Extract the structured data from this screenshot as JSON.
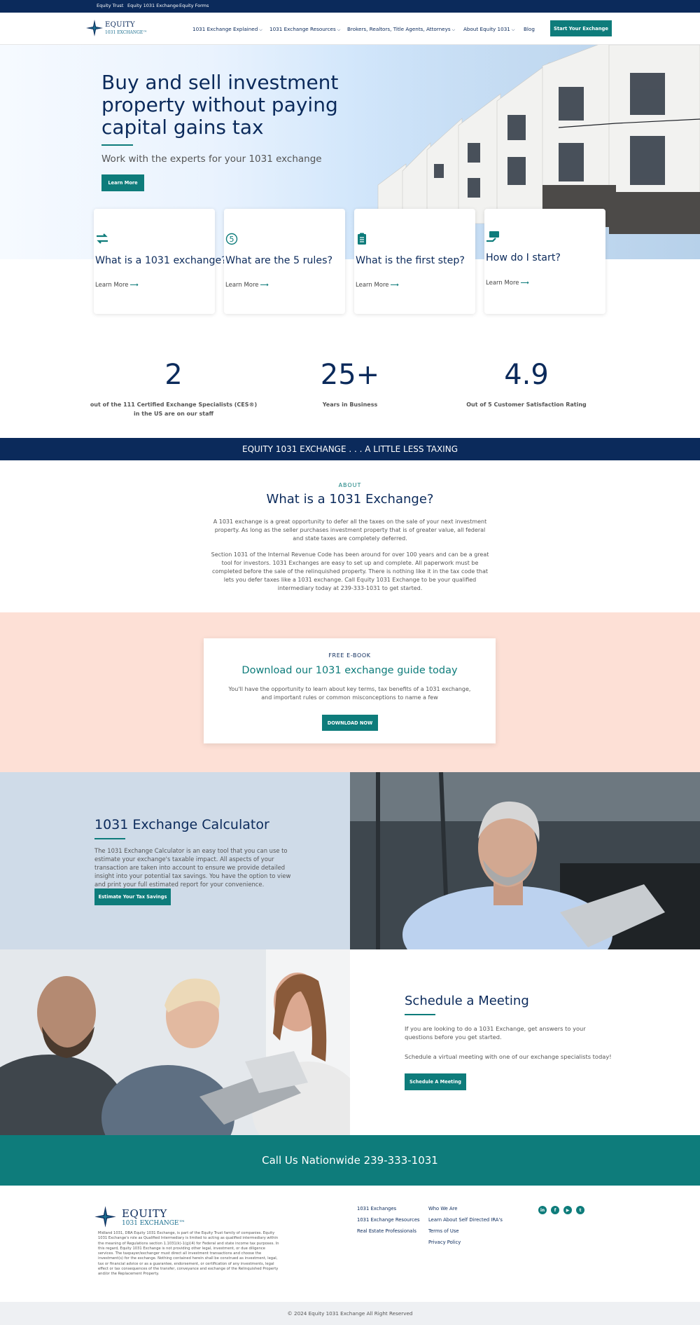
{
  "utility_bar": {
    "links": [
      "Equity Trust",
      "Equity 1031 Exchange",
      "Equity Forms"
    ]
  },
  "header": {
    "logo_line1": "EQUITY",
    "logo_line2": "1031 EXCHANGE™",
    "nav": [
      {
        "label": "1031 Exchange Explained",
        "dropdown": true
      },
      {
        "label": "1031 Exchange Resources",
        "dropdown": true
      },
      {
        "label": "Brokers, Realtors, Title Agents, Attorneys",
        "dropdown": true
      },
      {
        "label": "About Equity 1031",
        "dropdown": true
      },
      {
        "label": "Blog",
        "dropdown": false
      }
    ],
    "cta": "Start Your Exchange",
    "chevron": "⌵"
  },
  "hero": {
    "title": "Buy and sell investment property without paying capital gains tax",
    "subtitle": "Work with the experts for your 1031 exchange",
    "button": "Learn More"
  },
  "cards": [
    {
      "icon": "exchange-arrows-icon",
      "title": "What is a 1031 exchange?",
      "link": "Learn More"
    },
    {
      "icon": "number-five-icon",
      "title": "What are the 5 rules?",
      "link": "Learn More"
    },
    {
      "icon": "clipboard-list-icon",
      "title": "What is the first step?",
      "link": "Learn More"
    },
    {
      "icon": "money-hand-icon",
      "title": "How do I start?",
      "link": "Learn More"
    }
  ],
  "arrow": "⟶",
  "stats": [
    {
      "value": "2",
      "label": "out of the 111 Certified Exchange Specialists (CES®) in the US are on our staff"
    },
    {
      "value": "25+",
      "label": "Years in Business"
    },
    {
      "value": "4.9",
      "label": "Out of 5 Customer Satisfaction Rating"
    }
  ],
  "band": {
    "text": "EQUITY 1031 EXCHANGE . . . A LITTLE LESS TAXING"
  },
  "about": {
    "kicker": "ABOUT",
    "title": "What is a 1031 Exchange?",
    "p1": "A 1031 exchange is a great opportunity to defer all the taxes on the sale of your next investment property.  As long as the seller purchases investment property that is of greater value, all federal and state taxes are completely deferred.",
    "p2": "Section 1031 of the Internal Revenue Code has been around for over 100 years and can be a great tool for investors.  1031 Exchanges are easy to set up and complete.  All paperwork must be completed before the sale of the relinquished property. There is nothing like it in the tax code that lets you defer taxes like a 1031 exchange.  Call Equity 1031 Exchange to be your qualified intermediary today at 239-333-1031 to get started."
  },
  "ebook": {
    "kicker": "FREE E-BOOK",
    "title": "Download our 1031 exchange guide today",
    "text": "You'll have the opportunity to learn about key terms, tax benefits of a 1031 exchange, and important rules or common misconceptions to name a few",
    "button": "DOWNLOAD NOW"
  },
  "calculator": {
    "title": "1031 Exchange Calculator",
    "text": "The 1031 Exchange Calculator is an easy tool that you can use to estimate your exchange's taxable impact. All aspects of your transaction are taken into account to ensure we provide detailed insight into your potential tax savings. You have the option to view and print your full estimated report for your convenience.",
    "button": "Estimate Your Tax Savings"
  },
  "meeting": {
    "title": "Schedule a Meeting",
    "p1": "If you are looking to do a 1031 Exchange, get answers to your questions before you get started.",
    "p2": "Schedule a virtual meeting with one of our exchange specialists today!",
    "button": "Schedule A Meeting"
  },
  "call": {
    "text": "Call Us Nationwide 239-333-1031"
  },
  "footer": {
    "logo_line1": "EQUITY",
    "logo_line2": "1031 EXCHANGE™",
    "disclaimer": "Midland 1031, DBA Equity 1031 Exchange, is part of the Equity Trust family of companies. Equity 1031 Exchange's role as Qualified Intermediary is limited to acting as qualified intermediary within the meaning of Regulations section 1.1031(k)-1(g)(4) for Federal and state income tax purposes. In this regard, Equity 1031 Exchange is not providing other legal, investment, or due diligence services. The taxpayer/exchanger must direct all investment transactions and choose the investment(s) for the exchange. Nothing contained herein shall be construed as investment, legal, tax or financial advice or as a guarantee, endorsement, or certification of any investments, legal effect or tax consequences of the transfer, conveyance and exchange of the Relinquished Property and/or the Replacement Property.",
    "col1": [
      "1031 Exchanges",
      "1031 Exchange Resources",
      "Real Estate Professionals"
    ],
    "col2": [
      "Who We Are",
      "Learn About Self Directed IRA's",
      "Terms of Use",
      "Privacy Policy"
    ],
    "social": [
      {
        "icon": "linkedin-icon",
        "glyph": "in"
      },
      {
        "icon": "facebook-icon",
        "glyph": "f"
      },
      {
        "icon": "youtube-icon",
        "glyph": "▶"
      },
      {
        "icon": "twitter-icon",
        "glyph": "t"
      }
    ],
    "copyright": "© 2024 Equity 1031 Exchange  All Right Reserved"
  },
  "colors": {
    "navy": "#0b2a5b",
    "teal": "#0e7c7b",
    "peach": "#fde0d6",
    "light_blue": "#cfdbe8"
  }
}
